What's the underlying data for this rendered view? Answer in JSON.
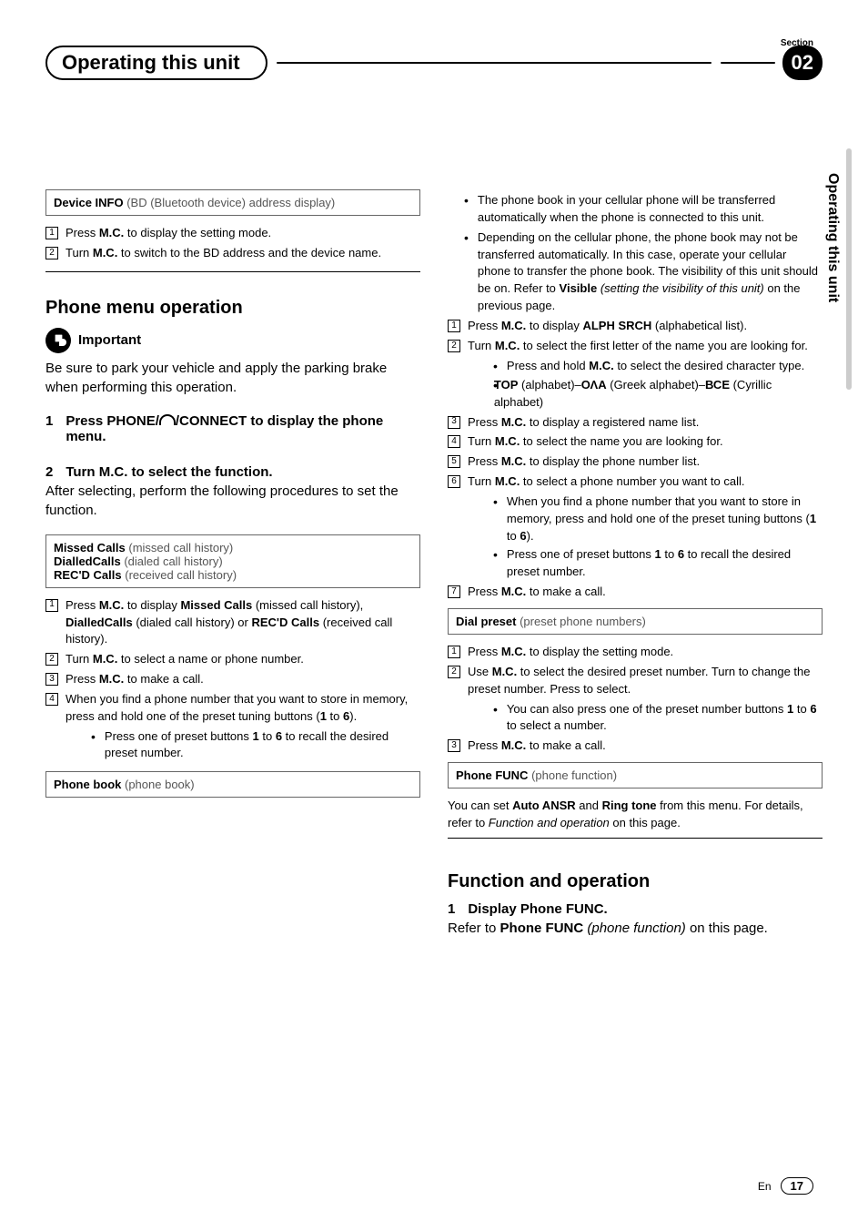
{
  "header": {
    "section_label": "Section",
    "title": "Operating this unit",
    "section_number": "02"
  },
  "side_tab": "Operating this unit",
  "col1": {
    "device_info": {
      "title": "Device INFO",
      "sub": " (BD (Bluetooth device) address display)"
    },
    "device_steps": [
      {
        "n": "1",
        "pre": "Press ",
        "b": "M.C.",
        "post": " to display the setting mode."
      },
      {
        "n": "2",
        "pre": "Turn ",
        "b": "M.C.",
        "post": " to switch to the BD address and the device name."
      }
    ],
    "h2_phone_menu": "Phone menu operation",
    "important_label": "Important",
    "important_text": "Be sure to park your vehicle and apply the parking brake when performing this operation.",
    "step1": {
      "n": "1",
      "pre": "Press PHONE/",
      "post": "/CONNECT to display the phone menu."
    },
    "step2": {
      "n": "2",
      "head": "Turn M.C. to select the function.",
      "body": "After selecting, perform the following procedures to set the function."
    },
    "calls_box": {
      "l1b": "Missed Calls",
      "l1s": " (missed call history)",
      "l2b": "DialledCalls",
      "l2s": " (dialed call history)",
      "l3b": "REC'D Calls",
      "l3s": " (received call history)"
    },
    "calls_steps": {
      "s1": {
        "n": "1",
        "t": "Press <b>M.C.</b> to display <b>Missed Calls</b> (missed call history), <b>DialledCalls</b> (dialed call history) or <b>REC'D Calls</b> (received call history)."
      },
      "s2": {
        "n": "2",
        "t": "Turn <b>M.C.</b> to select a name or phone number."
      },
      "s3": {
        "n": "3",
        "t": "Press <b>M.C.</b> to make a call."
      },
      "s4": {
        "n": "4",
        "t": "When you find a phone number that you want to store in memory, press and hold one of the preset tuning buttons (<b>1</b> to <b>6</b>)."
      },
      "s4b": "Press one of preset buttons <b>1</b> to <b>6</b> to recall the desired preset number."
    },
    "phonebook_box": {
      "title": "Phone book",
      "sub": " (phone book)"
    }
  },
  "col2": {
    "intro_bullets": [
      "The phone book in your cellular phone will be transferred automatically when the phone is connected to this unit.",
      "Depending on the cellular phone, the phone book may not be transferred automatically. In this case, operate your cellular phone to transfer the phone book. The visibility of this unit should be on. Refer to <b>Visible</b> <i>(setting the visibility of this unit)</i> on the previous page."
    ],
    "pb_steps": {
      "s1": {
        "n": "1",
        "t": "Press <b>M.C.</b> to display <b>ALPH SRCH</b> (alphabetical list)."
      },
      "s2": {
        "n": "2",
        "t": "Turn <b>M.C.</b> to select the first letter of the name you are looking for."
      },
      "s2b1": "Press and hold <b>M.C.</b> to select the desired character type.",
      "s2b2": "<b>TOP</b> (alphabet)–<b>ΟΛΑ</b> (Greek alphabet)–<b>ВСЕ</b> (Cyrillic alphabet)",
      "s3": {
        "n": "3",
        "t": "Press <b>M.C.</b> to display a registered name list."
      },
      "s4": {
        "n": "4",
        "t": "Turn <b>M.C.</b> to select the name you are looking for."
      },
      "s5": {
        "n": "5",
        "t": "Press <b>M.C.</b> to display the phone number list."
      },
      "s6": {
        "n": "6",
        "t": "Turn <b>M.C.</b> to select a phone number you want to call."
      },
      "s6b1": "When you find a phone number that you want to store in memory, press and hold one of the preset tuning buttons (<b>1</b> to <b>6</b>).",
      "s6b2": "Press one of preset buttons <b>1</b> to <b>6</b> to recall the desired preset number.",
      "s7": {
        "n": "7",
        "t": "Press <b>M.C.</b> to make a call."
      }
    },
    "dial_preset_box": {
      "title": "Dial preset",
      "sub": " (preset phone numbers)"
    },
    "dp_steps": {
      "s1": {
        "n": "1",
        "t": "Press <b>M.C.</b> to display the setting mode."
      },
      "s2": {
        "n": "2",
        "t": "Use <b>M.C.</b> to select the desired preset number. Turn to change the preset number. Press to select."
      },
      "s2b": "You can also press one of the preset number buttons <b>1</b> to <b>6</b> to select a number.",
      "s3": {
        "n": "3",
        "t": "Press <b>M.C.</b> to make a call."
      }
    },
    "phone_func_box": {
      "title": "Phone FUNC",
      "sub": " (phone function)"
    },
    "phone_func_text": "You can set <b>Auto ANSR</b> and <b>Ring tone</b> from this menu. For details, refer to <i>Function and operation</i> on this page.",
    "h2_func": "Function and operation",
    "func_step1": {
      "n": "1",
      "head": "Display Phone FUNC.",
      "body": "Refer to <b>Phone FUNC</b> <i>(phone function)</i> on this page."
    }
  },
  "footer": {
    "lang": "En",
    "page": "17"
  }
}
